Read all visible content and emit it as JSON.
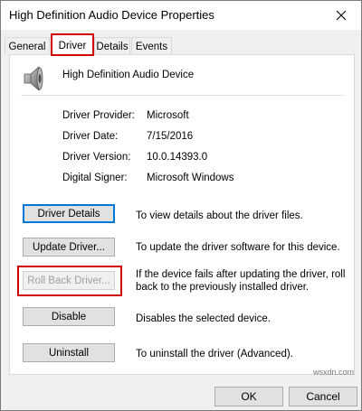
{
  "window": {
    "title": "High Definition Audio Device Properties"
  },
  "tabs": [
    {
      "label": "General"
    },
    {
      "label": "Driver"
    },
    {
      "label": "Details"
    },
    {
      "label": "Events"
    }
  ],
  "device": {
    "name": "High Definition Audio Device",
    "icon": "speaker-icon"
  },
  "driver_info": {
    "provider_label": "Driver Provider:",
    "provider_value": "Microsoft",
    "date_label": "Driver Date:",
    "date_value": "7/15/2016",
    "version_label": "Driver Version:",
    "version_value": "10.0.14393.0",
    "signer_label": "Digital Signer:",
    "signer_value": "Microsoft Windows"
  },
  "actions": {
    "details_label": "Driver Details",
    "details_desc": "To view details about the driver files.",
    "update_label": "Update Driver...",
    "update_desc": "To update the driver software for this device.",
    "rollback_label": "Roll Back Driver...",
    "rollback_desc_1": "If the device fails after updating the driver, roll",
    "rollback_desc_2": "back to the previously installed driver.",
    "disable_label": "Disable",
    "disable_desc": "Disables the selected device.",
    "uninstall_label": "Uninstall",
    "uninstall_desc": "To uninstall the driver (Advanced)."
  },
  "footer": {
    "ok_label": "OK",
    "cancel_label": "Cancel"
  },
  "watermark": "wsxdn.com",
  "colors": {
    "highlight": "#d40000",
    "focus": "#0078d7"
  }
}
